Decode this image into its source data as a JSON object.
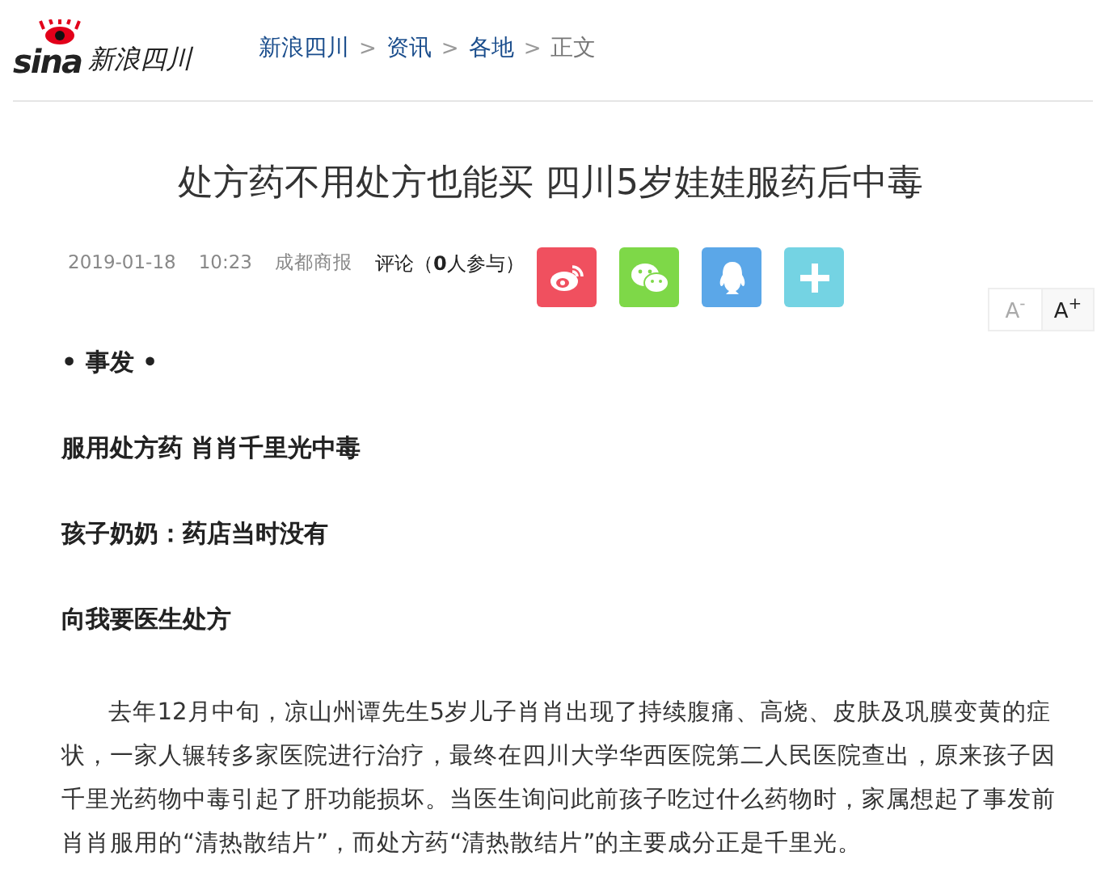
{
  "header": {
    "logo_brand": "sina",
    "logo_site": "新浪四川",
    "breadcrumb": [
      {
        "label": "新浪四川",
        "kind": "link"
      },
      {
        "label": "资讯",
        "kind": "link"
      },
      {
        "label": "各地",
        "kind": "link"
      },
      {
        "label": "正文",
        "kind": "current"
      }
    ],
    "separator": ">"
  },
  "title": "处方药不用处方也能买 四川5岁娃娃服药后中毒",
  "meta": {
    "date": "2019-01-18",
    "time": "10:23",
    "source": "成都商报",
    "comments": "评论（**0**人参与）"
  },
  "share": [
    {
      "kind": "weibo",
      "color": "#f0505f"
    },
    {
      "kind": "wechat",
      "color": "#7ed848"
    },
    {
      "kind": "qq",
      "color": "#5ba7e8"
    },
    {
      "kind": "more",
      "color": "#74d3e3"
    }
  ],
  "font_size": [
    {
      "label": "A",
      "sign": "-",
      "selected": false
    },
    {
      "label": "A",
      "sign": "+",
      "selected": true
    }
  ],
  "body": [
    {
      "kind": "heading",
      "text": "• 事发 •"
    },
    {
      "kind": "heading",
      "text": "服用处方药 肖肖千里光中毒"
    },
    {
      "kind": "heading",
      "text": "孩子奶奶：药店当时没有"
    },
    {
      "kind": "heading",
      "text": "向我要医生处方"
    },
    {
      "kind": "paragraph",
      "text": "去年12月中旬，凉山州谭先生5岁儿子肖肖出现了持续腹痛、高烧、皮肤及巩膜变黄的症状，一家人辗转多家医院进行治疗，最终在四川大学华西医院第二人民医院查出，原来孩子因千里光药物中毒引起了肝功能损坏。当医生询问此前孩子吃过什么药物时，家属想起了事发前肖肖服用的“清热散结片”，而处方药“清热散结片”的主要成分正是千里光。"
    }
  ]
}
